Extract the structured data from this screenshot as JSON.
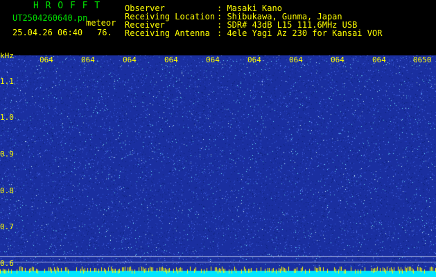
{
  "header": {
    "brand": "H R O F F T",
    "file_name": "UT2504260640.pn",
    "tag": "meteor",
    "datetime": "25.04.26 06:40",
    "gain_value": "76.",
    "meta": [
      {
        "label": "Observer",
        "value": ": Masaki Kano"
      },
      {
        "label": "Receiving Location",
        "value": ": Shibukawa, Gunma, Japan"
      },
      {
        "label": "Receiver",
        "value": ": SDR# 43dB L15 111.6MHz USB"
      },
      {
        "label": "Receiving Antenna",
        "value": ": 4ele Yagi Az 230 for Kansai VOR"
      }
    ]
  },
  "colors": {
    "header_green": "#00e000",
    "label_yellow": "#ffff00",
    "background_blue": "#1a2fa0",
    "speck_cyan": "#6ee6ff",
    "baseline_cyan": "#00e5ff"
  },
  "chart_data": {
    "type": "heatmap",
    "title": "",
    "ylabel": "kHz",
    "x_tick_labels": [
      "064",
      "064",
      "064",
      "064",
      "064",
      "064",
      "064",
      "064",
      "064",
      "0650"
    ],
    "y_ticks": [
      {
        "value": 1.1,
        "label": "1.1"
      },
      {
        "value": 1.0,
        "label": "1.0"
      },
      {
        "value": 0.9,
        "label": "0.9"
      },
      {
        "value": 0.8,
        "label": "0.8"
      },
      {
        "value": 0.7,
        "label": "0.7"
      },
      {
        "value": 0.6,
        "label": "0.6"
      }
    ],
    "ylim": [
      0.59,
      1.17
    ],
    "xlim": [
      "06:40",
      "06:50"
    ],
    "grid": false,
    "notes": "uniform noise background, no visible meteor echoes"
  }
}
